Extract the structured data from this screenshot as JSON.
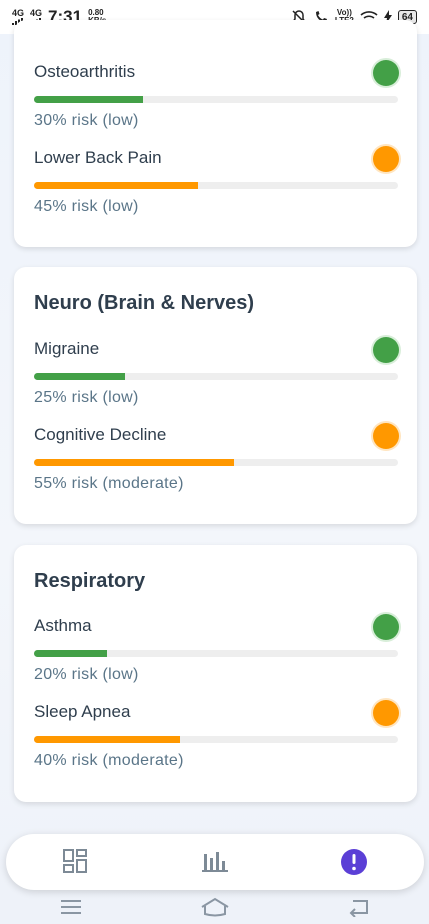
{
  "status_bar": {
    "network1": "4G",
    "network2": "4G",
    "time": "7:31",
    "speed_value": "0.80",
    "speed_unit": "KB/s",
    "volte": "Vo))",
    "lte": "LTE2",
    "battery": "64"
  },
  "cards": [
    {
      "title": "",
      "items": [
        {
          "name": "Osteoarthritis",
          "risk_text": "30% risk (low)",
          "percent": 30,
          "color": "#43a047"
        },
        {
          "name": "Lower Back Pain",
          "risk_text": "45% risk (low)",
          "percent": 45,
          "color": "#ff9800"
        }
      ]
    },
    {
      "title": "Neuro (Brain & Nerves)",
      "items": [
        {
          "name": "Migraine",
          "risk_text": "25% risk (low)",
          "percent": 25,
          "color": "#43a047"
        },
        {
          "name": "Cognitive Decline",
          "risk_text": "55% risk (moderate)",
          "percent": 55,
          "color": "#ff9800"
        }
      ]
    },
    {
      "title": "Respiratory",
      "items": [
        {
          "name": "Asthma",
          "risk_text": "20% risk (low)",
          "percent": 20,
          "color": "#43a047"
        },
        {
          "name": "Sleep Apnea",
          "risk_text": "40% risk (moderate)",
          "percent": 40,
          "color": "#ff9800"
        }
      ]
    }
  ],
  "bottom_nav": {
    "items": [
      {
        "icon": "dashboard-icon"
      },
      {
        "icon": "bar-chart-icon"
      },
      {
        "icon": "alert-icon",
        "active": true
      }
    ],
    "accent": "#5b3fd6"
  },
  "system_nav": {
    "items": [
      "menu-icon",
      "home-icon",
      "back-icon"
    ]
  }
}
